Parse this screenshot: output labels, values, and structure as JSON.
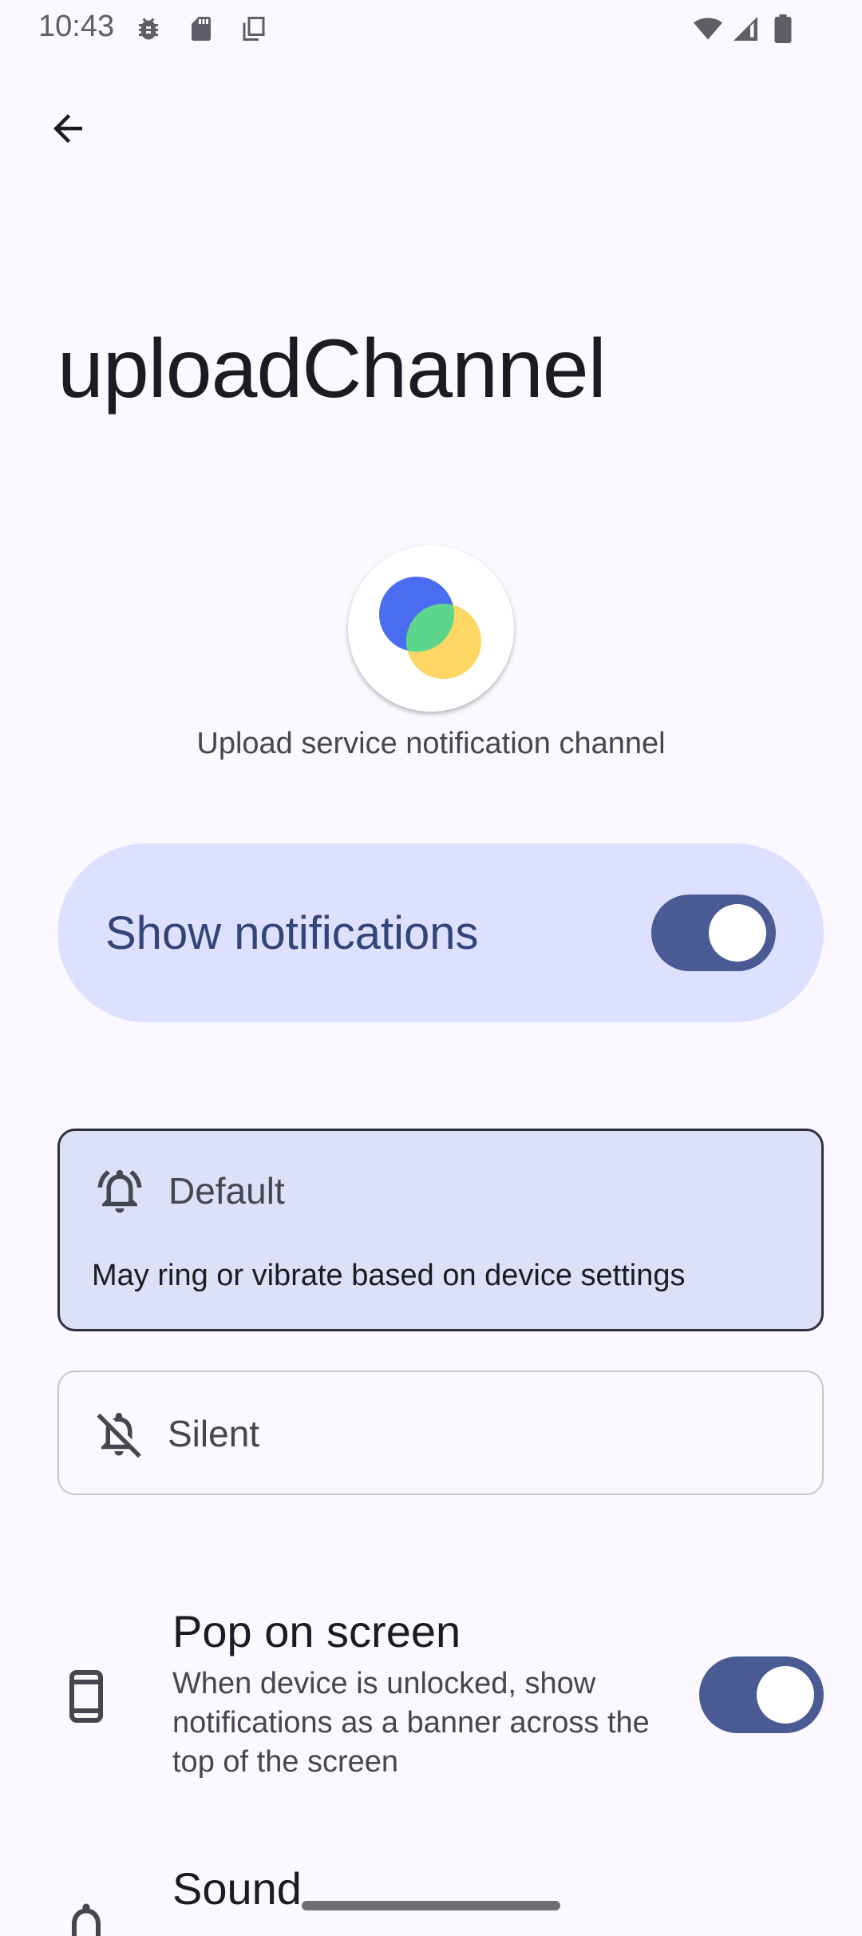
{
  "status_bar": {
    "time": "10:43",
    "icons": [
      "debug-icon",
      "sd-card-icon",
      "copy-icon",
      "wifi-icon",
      "signal-icon",
      "battery-icon"
    ]
  },
  "header": {
    "back_icon": "arrow-back-icon"
  },
  "channel": {
    "title": "uploadChannel",
    "description": "Upload service notification channel",
    "app_icon": "app-logo-icon"
  },
  "master_toggle": {
    "label": "Show notifications",
    "enabled": true
  },
  "importance": {
    "default": {
      "label": "Default",
      "summary": "May ring or vibrate based on device settings",
      "selected": true,
      "icon": "bell-ring-icon"
    },
    "silent": {
      "label": "Silent",
      "selected": false,
      "icon": "bell-off-icon"
    }
  },
  "preferences": {
    "pop_on_screen": {
      "title": "Pop on screen",
      "summary": "When device is unlocked, show notifications as a banner across the top of the screen",
      "enabled": true,
      "icon": "phone-icon"
    },
    "sound": {
      "title": "Sound",
      "icon": "bell-icon"
    }
  },
  "colors": {
    "accent": "#4a5a92",
    "card": "#dde1ff",
    "background": "#fbf8ff"
  }
}
